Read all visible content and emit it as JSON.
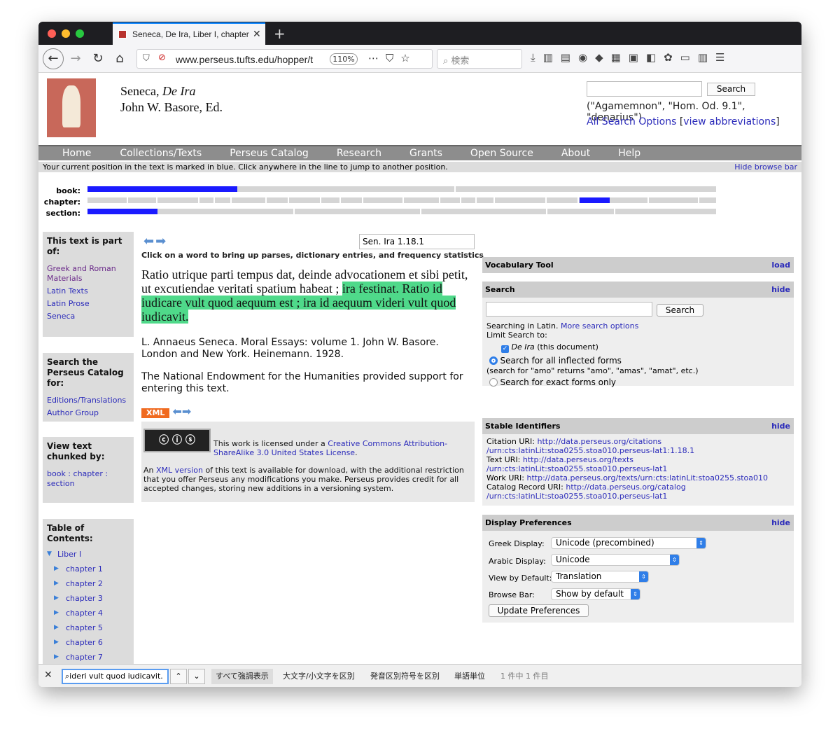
{
  "browser": {
    "tab_title": "Seneca, De Ira, Liber I, chapter",
    "url": "www.perseus.tufts.edu/hopper/t",
    "zoom": "110%",
    "search_placeholder": "検索"
  },
  "header": {
    "title_author": "Seneca, ",
    "title_work": "De Ira",
    "editor": "John W. Basore, Ed.",
    "search_button": "Search",
    "search_hint": "(\"Agamemnon\", \"Hom. Od. 9.1\", \"denarius\")",
    "all_search_options": "All Search Options",
    "view_abbreviations": "view abbreviations"
  },
  "menu": [
    "Home",
    "Collections/Texts",
    "Perseus Catalog",
    "Research",
    "Grants",
    "Open Source",
    "About",
    "Help"
  ],
  "browse": {
    "note": "Your current position in the text is marked in blue. Click anywhere in the line to jump to another position.",
    "hide": "Hide browse bar",
    "book_label": "book:",
    "chapter_label": "chapter:",
    "section_label": "section:"
  },
  "sidebar": {
    "part_of_title": "This text is part of:",
    "part_of_links": [
      "Greek and Roman Materials",
      "Latin Texts",
      "Latin Prose",
      "Seneca"
    ],
    "catalog_title": "Search the Perseus Catalog for:",
    "catalog_links": [
      "Editions/Translations",
      "Author Group"
    ],
    "chunk_title": "View text chunked by:",
    "chunk_book": "book",
    "chunk_chapter": "chapter",
    "chunk_section": "section",
    "toc_title": "Table of Contents:",
    "toc_book": "Liber I",
    "toc_chapters": [
      "chapter 1",
      "chapter 2",
      "chapter 3",
      "chapter 4",
      "chapter 5",
      "chapter 6",
      "chapter 7"
    ]
  },
  "main": {
    "citation": "Sen. Ira 1.18.1",
    "click_hint": "Click on a word to bring up parses, dictionary entries, and frequency statistics",
    "latin_plain": "Ratio utrique parti tempus dat, deinde advocationem et sibi petit, ut excutiendae veritati spatium habeat ; ",
    "latin_highlight": "ira festinat. Ratio id iudicare vult quod aequum est ; ira id aequum videri vult quod iudicavit.",
    "bibliography": "L. Annaeus Seneca. Moral Essays: volume 1. John W. Basore. London and New York. Heinemann. 1928.",
    "neh": "The National Endowment for the Humanities provided support for entering this text.",
    "xml_badge": "XML",
    "license_prefix": "This work is licensed under a ",
    "license_link": "Creative Commons Attribution-ShareAlike 3.0 United States License",
    "license_suffix": ".",
    "xml_prefix": "An ",
    "xml_link": "XML version",
    "xml_suffix": " of this text is available for download, with the additional restriction that you offer Perseus any modifications you make. Perseus provides credit for all accepted changes, storing new additions in a versioning system."
  },
  "panels": {
    "vocab_title": "Vocabulary Tool",
    "vocab_action": "load",
    "search_title": "Search",
    "search_action": "hide",
    "search_button": "Search",
    "searching_in": "Searching in Latin. ",
    "more_options": "More search options",
    "limit_to": "Limit Search to:",
    "doc_title": "De Ira",
    "doc_suffix": " (this document)",
    "inflected": "Search for all inflected forms",
    "inflected_hint": "(search for \"amo\" returns \"amo\", \"amas\", \"amat\", etc.)",
    "exact": "Search for exact forms only",
    "stable_title": "Stable Identifiers",
    "stable_action": "hide",
    "citation_label": "Citation URI: ",
    "citation_uri_1": "http://data.perseus.org/citations",
    "citation_uri_2": "/urn:cts:latinLit:stoa0255.stoa010.perseus-lat1:1.18.1",
    "text_label": "Text URI: ",
    "text_uri_1": "http://data.perseus.org/texts",
    "text_uri_2": "/urn:cts:latinLit:stoa0255.stoa010.perseus-lat1",
    "work_label": "Work URI: ",
    "work_uri": "http://data.perseus.org/texts/urn:cts:latinLit:stoa0255.stoa010",
    "catalog_label": "Catalog Record URI: ",
    "catalog_uri_1": "http://data.perseus.org/catalog",
    "catalog_uri_2": "/urn:cts:latinLit:stoa0255.stoa010.perseus-lat1",
    "prefs_title": "Display Preferences",
    "prefs_action": "hide",
    "greek_label": "Greek Display:",
    "greek_value": "Unicode (precombined)",
    "arabic_label": "Arabic Display:",
    "arabic_value": "Unicode",
    "view_label": "View by Default:",
    "view_value": "Translation",
    "browse_label": "Browse Bar:",
    "browse_value": "Show by default",
    "update_button": "Update Preferences"
  },
  "findbar": {
    "query": "ideri vult quod iudicavit.",
    "highlight_all": "すべて強調表示",
    "match_case": "大文字/小文字を区別",
    "match_diacritics": "発音区別符号を区別",
    "whole_words": "単語単位",
    "result_count": "1 件中 1 件目"
  }
}
